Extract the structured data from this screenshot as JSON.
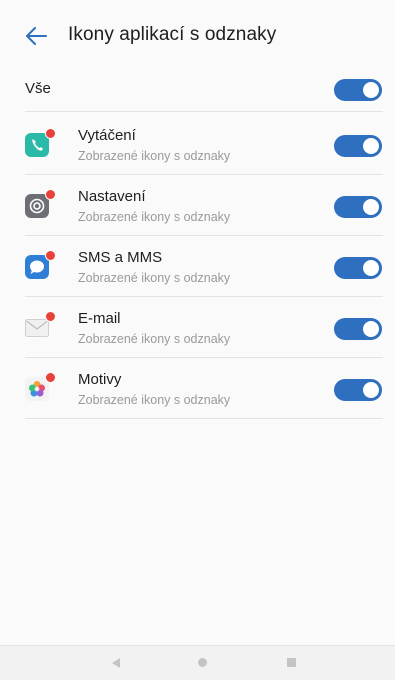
{
  "header": {
    "title": "Ikony aplikací s odznaky",
    "back_icon": "arrow-left-icon"
  },
  "all": {
    "label": "Vše",
    "enabled": true
  },
  "apps": [
    {
      "name": "Vytáčení",
      "subtitle": "Zobrazené ikony s odznaky",
      "icon": "phone-icon",
      "color": "#2bb9a8",
      "enabled": true
    },
    {
      "name": "Nastavení",
      "subtitle": "Zobrazené ikony s odznaky",
      "icon": "settings-gear-icon",
      "color": "#6d6f75",
      "enabled": true
    },
    {
      "name": "SMS a MMS",
      "subtitle": "Zobrazené ikony s odznaky",
      "icon": "message-bubble-icon",
      "color": "#2f7fd6",
      "enabled": true
    },
    {
      "name": "E-mail",
      "subtitle": "Zobrazené ikony s odznaky",
      "icon": "envelope-icon",
      "color": "#e9e9e9",
      "enabled": true
    },
    {
      "name": "Motivy",
      "subtitle": "Zobrazené ikony s odznaky",
      "icon": "themes-flower-icon",
      "color": "#f3f3f3",
      "enabled": true
    }
  ],
  "colors": {
    "accent": "#2f6fc0",
    "badge": "#e8413a"
  },
  "navbar": {
    "back_icon": "nav-back-triangle-icon",
    "home_icon": "nav-home-circle-icon",
    "recent_icon": "nav-recent-square-icon"
  }
}
